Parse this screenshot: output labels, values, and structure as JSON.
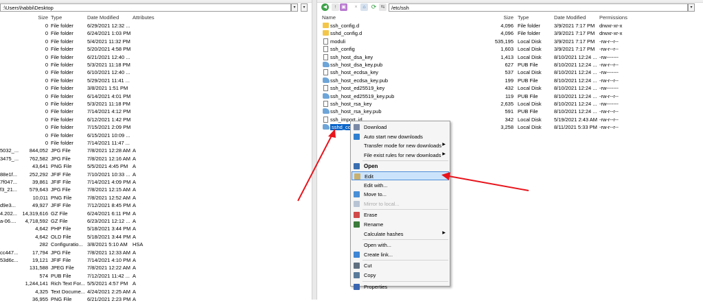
{
  "left": {
    "path": ":\\Users\\habbi\\Desktop",
    "columns": {
      "size": "Size",
      "type": "Type",
      "modified": "Date Modified",
      "attributes": "Attributes"
    },
    "rows": [
      {
        "name": "",
        "size": "0",
        "type": "File folder",
        "modified": "6/29/2021 12:32 ...",
        "attr": "",
        "icon": "none"
      },
      {
        "name": "",
        "size": "0",
        "type": "File folder",
        "modified": "6/24/2021 1:03 PM",
        "attr": "",
        "icon": "none"
      },
      {
        "name": "",
        "size": "0",
        "type": "File folder",
        "modified": "5/4/2021 11:32 PM",
        "attr": "",
        "icon": "none"
      },
      {
        "name": "",
        "size": "0",
        "type": "File folder",
        "modified": "5/20/2021 4:58 PM",
        "attr": "",
        "icon": "none"
      },
      {
        "name": "",
        "size": "0",
        "type": "File folder",
        "modified": "6/21/2021 12:40 ...",
        "attr": "",
        "icon": "none"
      },
      {
        "name": "",
        "size": "0",
        "type": "File folder",
        "modified": "5/3/2021 11:18 PM",
        "attr": "",
        "icon": "none"
      },
      {
        "name": "",
        "size": "0",
        "type": "File folder",
        "modified": "6/10/2021 12:40 ...",
        "attr": "",
        "icon": "none"
      },
      {
        "name": "",
        "size": "0",
        "type": "File folder",
        "modified": "5/29/2021 11:41 ...",
        "attr": "",
        "icon": "none"
      },
      {
        "name": "",
        "size": "0",
        "type": "File folder",
        "modified": "3/8/2021 1:51 PM",
        "attr": "",
        "icon": "none"
      },
      {
        "name": "",
        "size": "0",
        "type": "File folder",
        "modified": "6/14/2021 4:01 PM",
        "attr": "",
        "icon": "none"
      },
      {
        "name": "",
        "size": "0",
        "type": "File folder",
        "modified": "5/3/2021 11:18 PM",
        "attr": "",
        "icon": "none"
      },
      {
        "name": "",
        "size": "0",
        "type": "File folder",
        "modified": "7/14/2021 4:12 PM",
        "attr": "",
        "icon": "none"
      },
      {
        "name": "",
        "size": "0",
        "type": "File folder",
        "modified": "6/12/2021 1:42 PM",
        "attr": "",
        "icon": "none"
      },
      {
        "name": "",
        "size": "0",
        "type": "File folder",
        "modified": "7/15/2021 2:09 PM",
        "attr": "",
        "icon": "none"
      },
      {
        "name": "",
        "size": "0",
        "type": "File folder",
        "modified": "6/15/2021 10:09 ...",
        "attr": "",
        "icon": "none"
      },
      {
        "name": "",
        "size": "0",
        "type": "File folder",
        "modified": "7/14/2021 11:47 ...",
        "attr": "",
        "icon": "none"
      },
      {
        "name": "5032_...",
        "size": "844,052",
        "type": "JPG File",
        "modified": "7/8/2021 12:28 AM",
        "attr": "A",
        "icon": "none"
      },
      {
        "name": "3475_...",
        "size": "762,582",
        "type": "JPG File",
        "modified": "7/8/2021 12:16 AM",
        "attr": "A",
        "icon": "none"
      },
      {
        "name": "",
        "size": "43,641",
        "type": "PNG File",
        "modified": "5/5/2021 4:45 PM",
        "attr": "A",
        "icon": "none"
      },
      {
        "name": "88e1f...",
        "size": "252,292",
        "type": "JFIF File",
        "modified": "7/10/2021 10:33 ...",
        "attr": "A",
        "icon": "none"
      },
      {
        "name": "7f047...",
        "size": "39,861",
        "type": "JFIF File",
        "modified": "7/14/2021 4:09 PM",
        "attr": "A",
        "icon": "none"
      },
      {
        "name": "f3_21...",
        "size": "579,643",
        "type": "JPG File",
        "modified": "7/8/2021 12:15 AM",
        "attr": "A",
        "icon": "none"
      },
      {
        "name": "",
        "size": "10,011",
        "type": "PNG File",
        "modified": "7/8/2021 12:52 AM",
        "attr": "A",
        "icon": "none"
      },
      {
        "name": "d9e3...",
        "size": "49,927",
        "type": "JFIF File",
        "modified": "7/12/2021 8:45 PM",
        "attr": "A",
        "icon": "none"
      },
      {
        "name": "4.202...",
        "size": "14,319,616",
        "type": "GZ File",
        "modified": "6/24/2021 6:11 PM",
        "attr": "A",
        "icon": "none"
      },
      {
        "name": "a-06....",
        "size": "4,718,592",
        "type": "GZ File",
        "modified": "6/23/2021 12:12 ...",
        "attr": "A",
        "icon": "none"
      },
      {
        "name": "",
        "size": "4,642",
        "type": "PHP File",
        "modified": "5/18/2021 3:44 PM",
        "attr": "A",
        "icon": "none"
      },
      {
        "name": "",
        "size": "4,642",
        "type": "OLD File",
        "modified": "5/18/2021 3:44 PM",
        "attr": "A",
        "icon": "none"
      },
      {
        "name": "",
        "size": "282",
        "type": "Configuratio...",
        "modified": "3/8/2021 5:10 AM",
        "attr": "HSA",
        "icon": "none"
      },
      {
        "name": "cc447...",
        "size": "17,794",
        "type": "JPG File",
        "modified": "7/8/2021 12:33 AM",
        "attr": "A",
        "icon": "none"
      },
      {
        "name": "53d6c...",
        "size": "19,121",
        "type": "JFIF File",
        "modified": "7/14/2021 4:10 PM",
        "attr": "A",
        "icon": "none"
      },
      {
        "name": "",
        "size": "131,588",
        "type": "JPEG File",
        "modified": "7/8/2021 12:22 AM",
        "attr": "A",
        "icon": "none"
      },
      {
        "name": "",
        "size": "574",
        "type": "PUB File",
        "modified": "7/12/2021 11:42 ...",
        "attr": "A",
        "icon": "none"
      },
      {
        "name": "",
        "size": "1,244,141",
        "type": "Rich Text For...",
        "modified": "5/5/2021 4:57 PM",
        "attr": "A",
        "icon": "none"
      },
      {
        "name": "",
        "size": "4,325",
        "type": "Text Docume...",
        "modified": "4/24/2021 2:25 AM",
        "attr": "A",
        "icon": "none"
      },
      {
        "name": "",
        "size": "36,955",
        "type": "PNG File",
        "modified": "6/21/2021 2:23 PM",
        "attr": "A",
        "icon": "none"
      }
    ]
  },
  "right": {
    "path": "/etc/ssh",
    "columns": {
      "name": "Name",
      "size": "Size",
      "type": "Type",
      "modified": "Date Modified",
      "permissions": "Permissions"
    },
    "rows": [
      {
        "name": "ssh_config.d",
        "size": "4,096",
        "type": "File folder",
        "modified": "3/9/2021 7:17 PM",
        "perm": "drwxr-xr-x",
        "icon": "folder"
      },
      {
        "name": "sshd_config.d",
        "size": "4,096",
        "type": "File folder",
        "modified": "3/9/2021 7:17 PM",
        "perm": "drwxr-xr-x",
        "icon": "folder"
      },
      {
        "name": "moduli",
        "size": "535,195",
        "type": "Local Disk",
        "modified": "3/9/2021 7:17 PM",
        "perm": "-rw-r--r--",
        "icon": "doc"
      },
      {
        "name": "ssh_config",
        "size": "1,603",
        "type": "Local Disk",
        "modified": "3/9/2021 7:17 PM",
        "perm": "-rw-r--r--",
        "icon": "doc"
      },
      {
        "name": "ssh_host_dsa_key",
        "size": "1,413",
        "type": "Local Disk",
        "modified": "8/10/2021 12:24 ...",
        "perm": "-rw-------",
        "icon": "doc"
      },
      {
        "name": "ssh_host_dsa_key.pub",
        "size": "627",
        "type": "PUB File",
        "modified": "8/10/2021 12:24 ...",
        "perm": "-rw-r--r--",
        "icon": "pub"
      },
      {
        "name": "ssh_host_ecdsa_key",
        "size": "537",
        "type": "Local Disk",
        "modified": "8/10/2021 12:24 ...",
        "perm": "-rw-------",
        "icon": "doc"
      },
      {
        "name": "ssh_host_ecdsa_key.pub",
        "size": "199",
        "type": "PUB File",
        "modified": "8/10/2021 12:24 ...",
        "perm": "-rw-r--r--",
        "icon": "pub"
      },
      {
        "name": "ssh_host_ed25519_key",
        "size": "432",
        "type": "Local Disk",
        "modified": "8/10/2021 12:24 ...",
        "perm": "-rw-------",
        "icon": "doc"
      },
      {
        "name": "ssh_host_ed25519_key.pub",
        "size": "119",
        "type": "PUB File",
        "modified": "8/10/2021 12:24 ...",
        "perm": "-rw-r--r--",
        "icon": "pub"
      },
      {
        "name": "ssh_host_rsa_key",
        "size": "2,635",
        "type": "Local Disk",
        "modified": "8/10/2021 12:24 ...",
        "perm": "-rw-------",
        "icon": "doc"
      },
      {
        "name": "ssh_host_rsa_key.pub",
        "size": "591",
        "type": "PUB File",
        "modified": "8/10/2021 12:24 ...",
        "perm": "-rw-r--r--",
        "icon": "pub"
      },
      {
        "name": "ssh_import_id",
        "size": "342",
        "type": "Local Disk",
        "modified": "5/19/2021 2:43 AM",
        "perm": "-rw-r--r--",
        "icon": "doc"
      },
      {
        "name": "sshd_con",
        "size": "3,258",
        "type": "Local Disk",
        "modified": "8/11/2021 5:33 PM",
        "perm": "-rw-r--r--",
        "icon": "pub",
        "selected": true
      }
    ]
  },
  "context_menu": {
    "items": [
      {
        "label": "Download",
        "icon": "download-icon",
        "color": "#7a8aa6"
      },
      {
        "label": "Auto start new downloads",
        "icon": "auto-start-icon",
        "color": "#2f7fd0"
      },
      {
        "label": "Transfer mode for new downloads",
        "submenu": true
      },
      {
        "label": "File exist rules for new downloads",
        "submenu": true
      },
      {
        "sep": true
      },
      {
        "label": "Open",
        "icon": "open-icon",
        "color": "#3a6fb0",
        "bold": true
      },
      {
        "label": "Edit",
        "icon": "edit-icon",
        "color": "#c8b070",
        "highlighted": true
      },
      {
        "label": "Edit with..."
      },
      {
        "label": "Move to...",
        "icon": "move-icon",
        "color": "#4a8fd6"
      },
      {
        "label": "Mirror to local...",
        "icon": "mirror-icon",
        "color": "#b8c4d4",
        "disabled": true
      },
      {
        "sep": true
      },
      {
        "label": "Erase",
        "icon": "erase-icon",
        "color": "#d04a4a"
      },
      {
        "label": "Rename",
        "icon": "rename-icon",
        "color": "#3b7a3b"
      },
      {
        "label": "Calculate hashes",
        "submenu": true
      },
      {
        "sep": true
      },
      {
        "label": "Open with..."
      },
      {
        "label": "Create link...",
        "icon": "link-icon",
        "color": "#3f86d4"
      },
      {
        "sep": true
      },
      {
        "label": "Cut",
        "icon": "cut-icon",
        "color": "#607080"
      },
      {
        "label": "Copy",
        "icon": "copy-icon",
        "color": "#5a7a9a"
      },
      {
        "sep": true
      },
      {
        "label": "Properties",
        "icon": "properties-icon",
        "color": "#3a66b0"
      }
    ]
  },
  "annotations": {
    "arrow_color": "#e8141c"
  }
}
